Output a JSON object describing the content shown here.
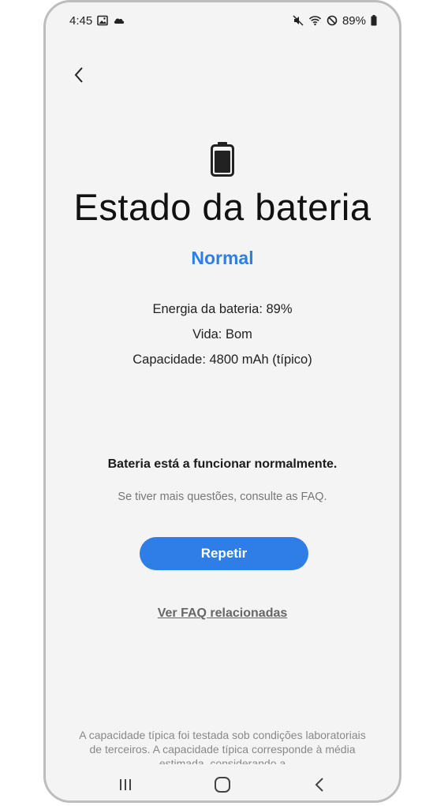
{
  "status_bar": {
    "time": "4:45",
    "battery_percent": "89%"
  },
  "icons": {
    "back": "chevron-left-icon",
    "gallery": "image-icon",
    "cloud": "cloud-icon",
    "mute": "mute-icon",
    "wifi": "wifi-icon",
    "dnd": "do-not-disturb-icon",
    "battery": "battery-icon"
  },
  "header": {
    "title": "Estado da bateria",
    "status": "Normal"
  },
  "info": {
    "energy": "Energia da bateria: 89%",
    "life": "Vida: Bom",
    "capacity": "Capacidade: 4800 mAh (típico)"
  },
  "message": {
    "main": "Bateria está a funcionar normalmente.",
    "hint": "Se tiver mais questões, consulte as FAQ."
  },
  "actions": {
    "repeat_label": "Repetir",
    "faq_label": "Ver FAQ relacionadas"
  },
  "footnote": "A capacidade típica foi testada sob condições laboratoriais de terceiros. A capacidade típica corresponde à média estimada, considerando a",
  "colors": {
    "accent": "#2f7de6",
    "background": "#f4f4f4"
  }
}
